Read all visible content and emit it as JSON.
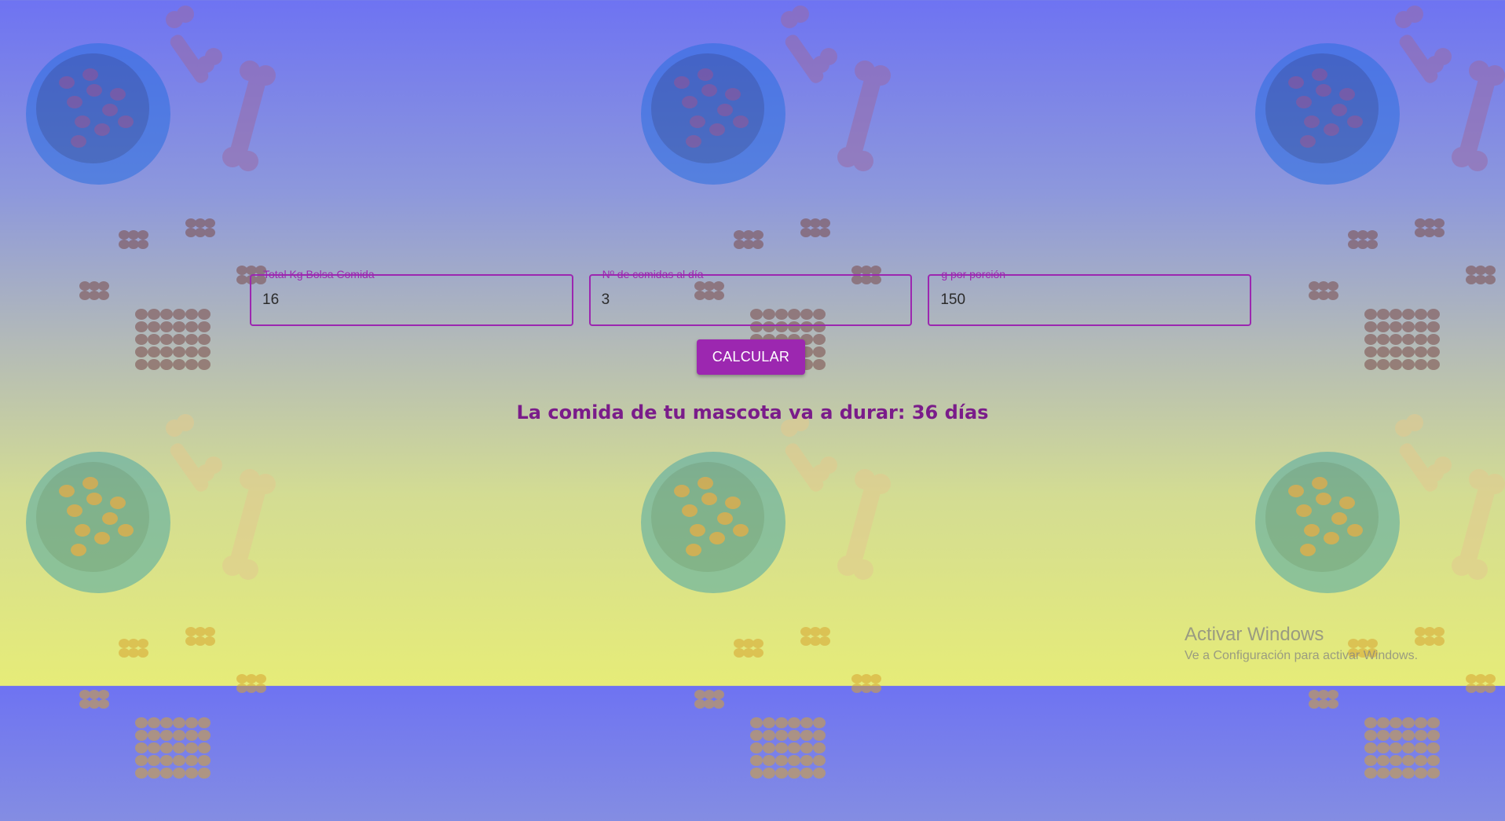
{
  "form": {
    "fields": [
      {
        "label": "Total Kg Bolsa Comida",
        "value": "16"
      },
      {
        "label": "Nº de comidas al día",
        "value": "3"
      },
      {
        "label": "g por porción",
        "value": "150"
      }
    ],
    "button_label": "CALCULAR"
  },
  "result_text": "La comida de tu mascota va a durar: 36 días",
  "watermark": {
    "title": "Activar Windows",
    "subtitle": "Ve a Configuración para activar Windows."
  },
  "colors": {
    "accent": "#9c27b0",
    "result": "#7a1c8a"
  }
}
